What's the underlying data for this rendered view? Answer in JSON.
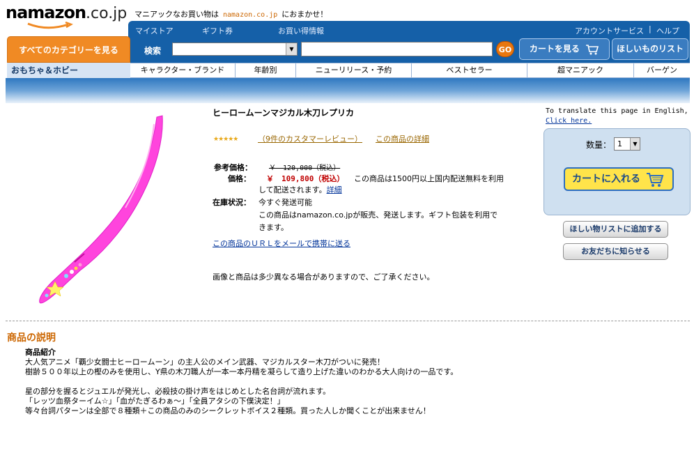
{
  "header": {
    "logo_name": "namazon",
    "logo_tld": ".co.jp",
    "tagline_before": "マニアックなお買い物は",
    "tagline_brand": "namazon.co.jp",
    "tagline_after": "におまかせ！"
  },
  "topnav": {
    "links": [
      "マイストア",
      "ギフト券",
      "お買い得情報"
    ],
    "account": "アカウントサービス",
    "separator": "|",
    "help": "ヘルプ"
  },
  "all_categories": "すべてのカテゴリーを見る",
  "search": {
    "label": "検索",
    "button": "GO",
    "value": ""
  },
  "buttons": {
    "cart": "カートを見る",
    "wishlist": "ほしいものリスト"
  },
  "category": "おもちゃ＆ホビー",
  "subnav": [
    "キャラクター・ブランド",
    "年齢別",
    "ニューリリース・予約",
    "ベストセラー",
    "超マニアック",
    "バーゲン"
  ],
  "product": {
    "title": "ヒーロームーンマジカル木刀レプリカ",
    "stars": "★★★★★",
    "rating": 5,
    "review_link": "（9件のカスタマーレビュー）",
    "detail_link": "この商品の詳細",
    "list_price_label": "参考価格：",
    "list_price": "￥　120,000（税込）",
    "price_label": "価格：",
    "price": "￥　109,800（税込）",
    "shipping_note_1": "この商品は1500円以上国内配送無料を利用",
    "shipping_note_2": "して配送されます。",
    "shipping_link": "詳細",
    "stock_label": "在庫状況：",
    "stock": "今すぐ発送可能",
    "seller_1": "この商品はnamazon.co.jpが販売、発送します。ギフト包装を利用で",
    "seller_2": "きます。",
    "email_link": "この商品のＵＲＬをメールで携帯に送る",
    "disclaimer": "画像と商品は多少異なる場合がありますので、ご了承ください。"
  },
  "sidebar": {
    "translate_text": "To translate this page in English,",
    "translate_link": "Click here.",
    "qty_label": "数量：",
    "qty_value": "1",
    "add_to_cart": "カートに入れる",
    "add_wishlist": "ほしい物リストに追加する",
    "tell_friend": "お友だちに知らせる"
  },
  "description": {
    "heading": "商品の説明",
    "subheading": "商品紹介",
    "lines_1": [
      "大人気アニメ「覇少女闘士ヒーロームーン」の主人公のメイン武器、マジカルスター木刀がついに発売！",
      "樹齢５００年以上の樫のみを使用し、Y県の木刀職人が一本一本丹精を凝らして造り上げた違いのわかる大人向けの一品です。"
    ],
    "lines_2": [
      "星の部分を握るとジュエルが発光し、必殺技の掛け声をはじめとした名台詞が流れます。",
      "「レッツ血祭ターイム☆」「血がたぎるわぁ～」「全員アタシの下僕決定！」",
      "等々台詞パターンは全部で８種類＋この商品のみのシークレットボイス２種類。買った人しか聞くことが出来ません！"
    ]
  },
  "colors": {
    "nav_blue": "#1560a8",
    "orange": "#f08a24",
    "price_red": "#c00000",
    "link_brown": "#996600",
    "sword_pink": "#ff44dd"
  }
}
